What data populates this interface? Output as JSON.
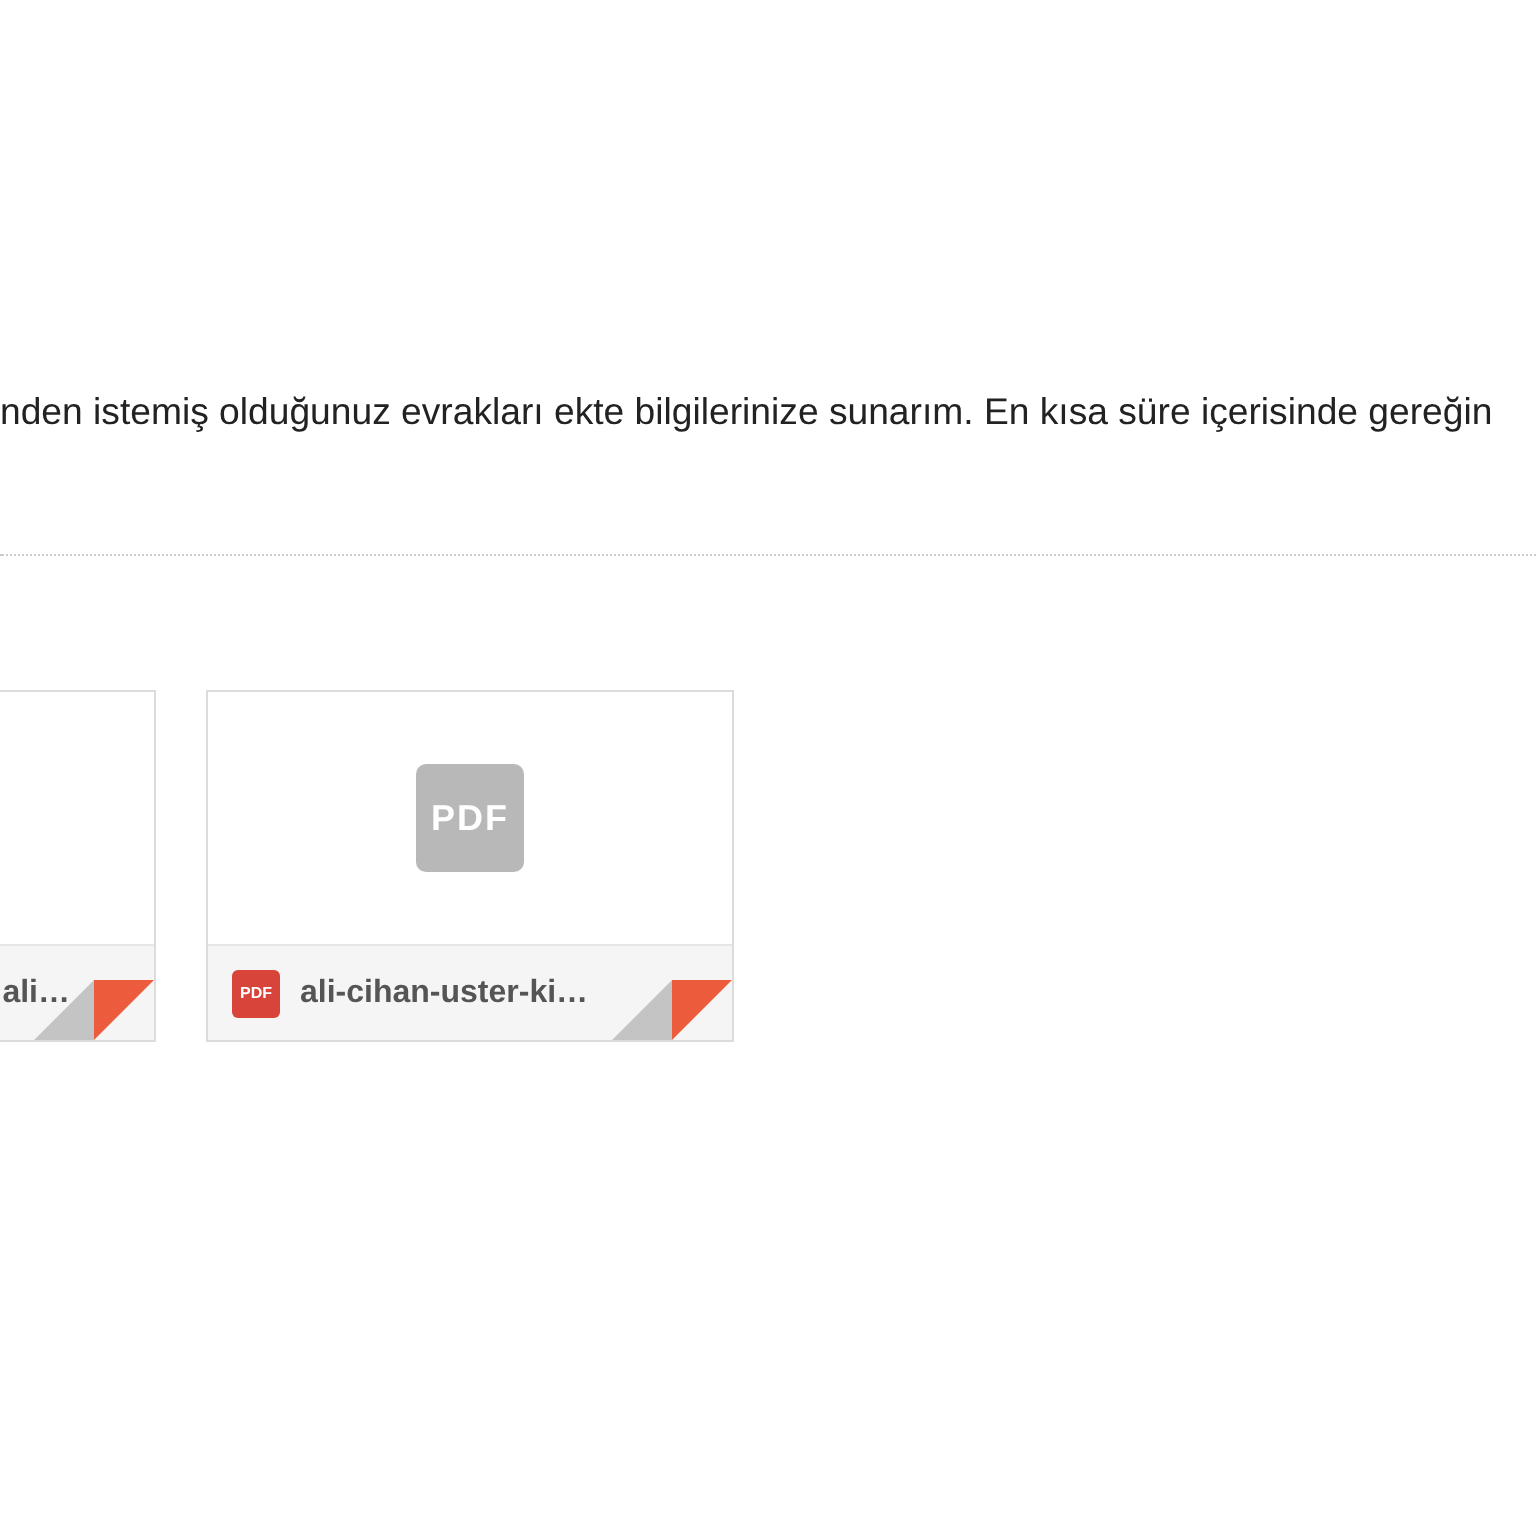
{
  "message": {
    "body": "nden istemiş olduğunuz evrakları ekte bilgilerinize sunarım. En kısa süre içerisinde gereğin"
  },
  "attachments": [
    {
      "name": "ali…"
    },
    {
      "name": "ali-cihan-uster-ki…",
      "badge": "PDF",
      "preview": "PDF"
    }
  ]
}
